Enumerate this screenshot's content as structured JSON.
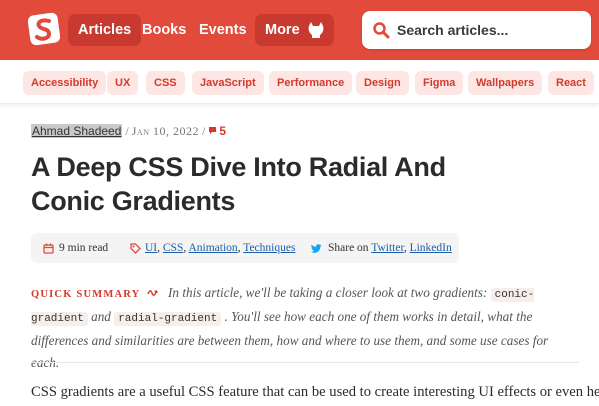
{
  "header": {
    "nav": [
      "Articles",
      "Books",
      "Events"
    ],
    "more_label": "More",
    "search_placeholder": "Search articles..."
  },
  "categories": [
    "Accessibility",
    "UX",
    "CSS",
    "JavaScript",
    "Performance",
    "Design",
    "Figma",
    "Wallpapers",
    "React"
  ],
  "article": {
    "author": "Ahmad Shadeed",
    "separator": "/",
    "date": "Jan 10, 2022",
    "comments": "5",
    "title": "A Deep CSS Dive Into Radial And Conic Gradients",
    "read_time": "9 min read",
    "tags": [
      "UI",
      "CSS",
      "Animation",
      "Techniques"
    ],
    "share_prefix": "Share on",
    "share_links": [
      "Twitter",
      "LinkedIn"
    ],
    "summary_label": "QUICK SUMMARY",
    "summary_part1": "In this article, we'll be taking a closer look at two gradients:",
    "summary_code1": "conic-gradient",
    "summary_and": "and",
    "summary_code2": "radial-gradient",
    "summary_part2": ". You'll see how each one of them works in detail, what the differences and similarities are between them, how and where to use them, and some use cases for each.",
    "body_start": "CSS gradients are a useful CSS feature that can be used to create interesting UI effects or even help"
  },
  "colors": {
    "brand_red": "#e24a3c",
    "chip_bg": "#fde6e3",
    "chip_text": "#d33a2c",
    "link_blue": "#1b5fa8"
  }
}
